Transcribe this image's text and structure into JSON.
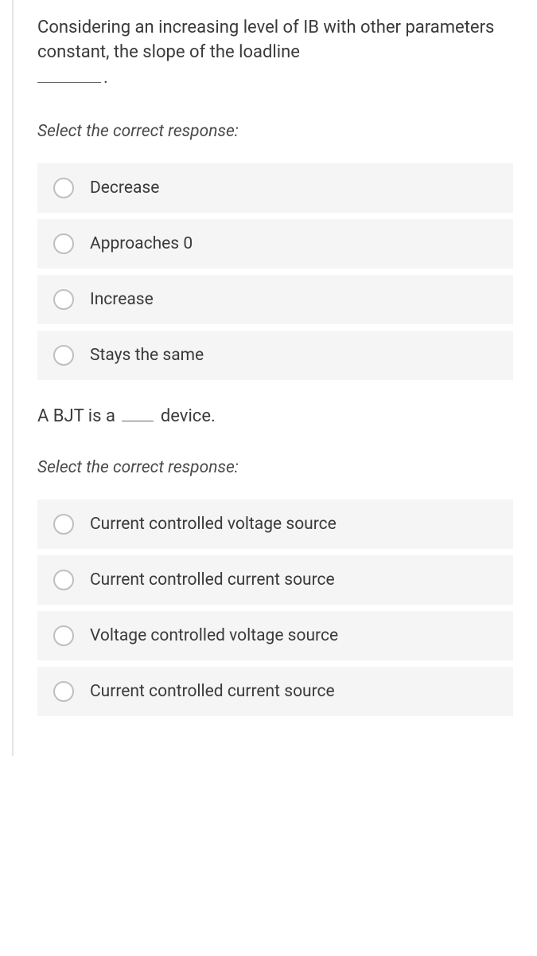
{
  "question1": {
    "text_part1": "Considering an increasing level of IB with other parameters constant, the slope of the loadline",
    "instruction": "Select the correct response:",
    "options": [
      "Decrease",
      "Approaches 0",
      "Increase",
      "Stays the same"
    ]
  },
  "question2": {
    "text_prefix": "A BJT is a ",
    "text_suffix": " device.",
    "instruction": "Select the correct response:",
    "options": [
      "Current controlled voltage source",
      "Current controlled current source",
      "Voltage controlled voltage source",
      "Current controlled current source"
    ]
  }
}
